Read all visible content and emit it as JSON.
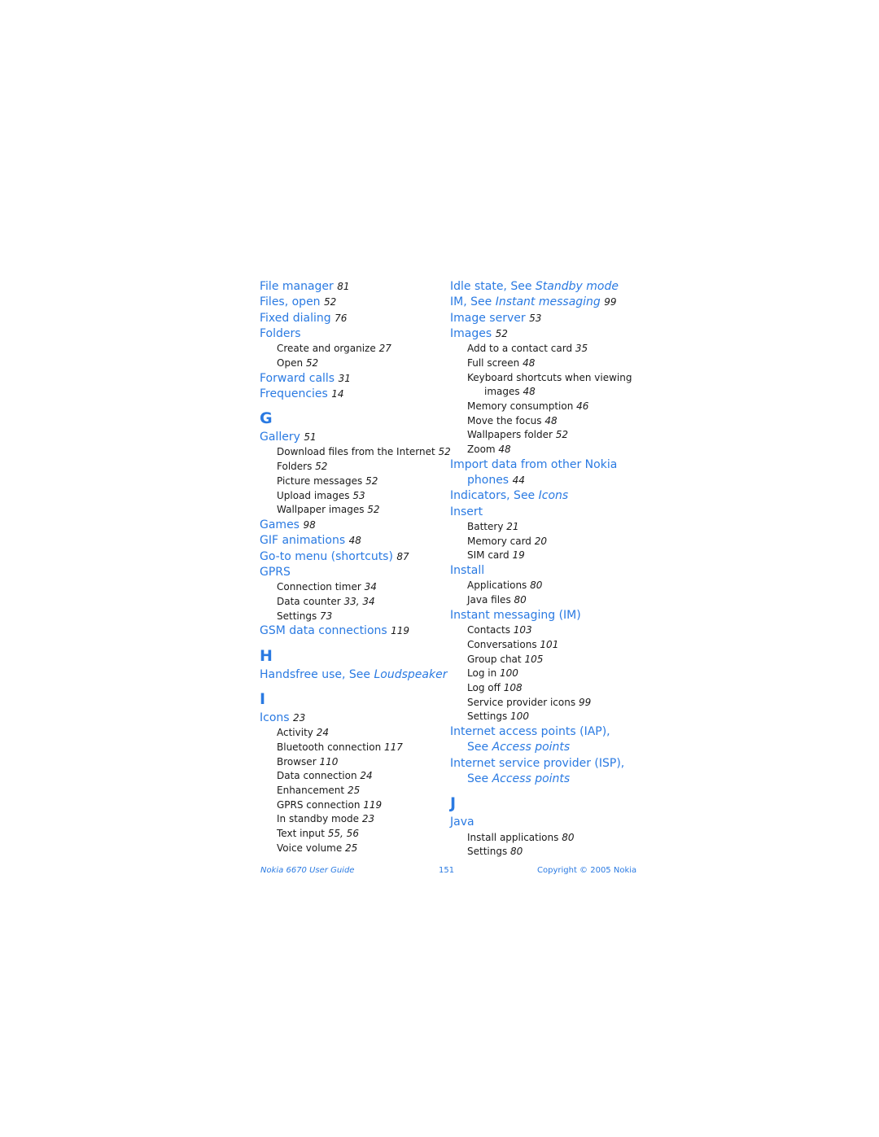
{
  "left_column": [
    {
      "type": "main",
      "text": "File manager",
      "pages": "81"
    },
    {
      "type": "main",
      "text": "Files, open",
      "pages": "52"
    },
    {
      "type": "main",
      "text": "Fixed dialing",
      "pages": "76"
    },
    {
      "type": "main",
      "text": "Folders",
      "pages": ""
    },
    {
      "type": "sub",
      "text": "Create and organize",
      "pages": "27"
    },
    {
      "type": "sub",
      "text": "Open",
      "pages": "52"
    },
    {
      "type": "main",
      "text": "Forward calls",
      "pages": "31"
    },
    {
      "type": "main",
      "text": "Frequencies",
      "pages": "14"
    },
    {
      "type": "letter",
      "text": "G"
    },
    {
      "type": "main",
      "text": "Gallery",
      "pages": "51"
    },
    {
      "type": "sub",
      "text": "Download files from the Internet",
      "pages": "52"
    },
    {
      "type": "sub",
      "text": "Folders",
      "pages": "52"
    },
    {
      "type": "sub",
      "text": "Picture messages",
      "pages": "52"
    },
    {
      "type": "sub",
      "text": "Upload images",
      "pages": "53"
    },
    {
      "type": "sub",
      "text": "Wallpaper images",
      "pages": "52"
    },
    {
      "type": "main",
      "text": "Games",
      "pages": "98"
    },
    {
      "type": "main",
      "text": "GIF animations",
      "pages": "48"
    },
    {
      "type": "main",
      "text": "Go-to menu (shortcuts)",
      "pages": "87"
    },
    {
      "type": "main",
      "text": "GPRS",
      "pages": ""
    },
    {
      "type": "sub",
      "text": "Connection timer",
      "pages": "34"
    },
    {
      "type": "sub",
      "text": "Data counter",
      "pages": "33, 34"
    },
    {
      "type": "sub",
      "text": "Settings",
      "pages": "73"
    },
    {
      "type": "main",
      "text": "GSM data connections",
      "pages": "119"
    },
    {
      "type": "letter",
      "text": "H"
    },
    {
      "type": "main",
      "text": "Handsfree use, See",
      "see": "Loudspeaker",
      "pages": ""
    },
    {
      "type": "letter",
      "text": "I"
    },
    {
      "type": "main",
      "text": "Icons",
      "pages": "23"
    },
    {
      "type": "sub",
      "text": "Activity",
      "pages": "24"
    },
    {
      "type": "sub",
      "text": "Bluetooth connection",
      "pages": "117"
    },
    {
      "type": "sub",
      "text": "Browser",
      "pages": "110"
    },
    {
      "type": "sub",
      "text": "Data connection",
      "pages": "24"
    },
    {
      "type": "sub",
      "text": "Enhancement",
      "pages": "25"
    },
    {
      "type": "sub",
      "text": "GPRS connection",
      "pages": "119"
    },
    {
      "type": "sub",
      "text": "In standby mode",
      "pages": "23"
    },
    {
      "type": "sub",
      "text": "Text input",
      "pages": "55, 56"
    },
    {
      "type": "sub",
      "text": "Voice volume",
      "pages": "25"
    }
  ],
  "right_column": [
    {
      "type": "main",
      "text": "Idle state, See",
      "see": "Standby mode",
      "pages": ""
    },
    {
      "type": "main",
      "text": "IM, See",
      "see": "Instant messaging",
      "pages": "99"
    },
    {
      "type": "main",
      "text": "Image server",
      "pages": "53"
    },
    {
      "type": "main",
      "text": "Images",
      "pages": "52"
    },
    {
      "type": "sub",
      "text": "Add to a contact card",
      "pages": "35"
    },
    {
      "type": "sub",
      "text": "Full screen",
      "pages": "48"
    },
    {
      "type": "sub",
      "text": "Keyboard shortcuts when viewing",
      "cont": "images",
      "pages": "48"
    },
    {
      "type": "sub",
      "text": "Memory consumption",
      "pages": "46"
    },
    {
      "type": "sub",
      "text": "Move the focus",
      "pages": "48"
    },
    {
      "type": "sub",
      "text": "Wallpapers folder",
      "pages": "52"
    },
    {
      "type": "sub",
      "text": "Zoom",
      "pages": "48"
    },
    {
      "type": "main",
      "text": "Import data from other Nokia",
      "cont": "phones",
      "pages": "44"
    },
    {
      "type": "main",
      "text": "Indicators, See",
      "see": "Icons",
      "pages": ""
    },
    {
      "type": "main",
      "text": "Insert",
      "pages": ""
    },
    {
      "type": "sub",
      "text": "Battery",
      "pages": "21"
    },
    {
      "type": "sub",
      "text": "Memory card",
      "pages": "20"
    },
    {
      "type": "sub",
      "text": "SIM card",
      "pages": "19"
    },
    {
      "type": "main",
      "text": "Install",
      "pages": ""
    },
    {
      "type": "sub",
      "text": "Applications",
      "pages": "80"
    },
    {
      "type": "sub",
      "text": "Java files",
      "pages": "80"
    },
    {
      "type": "main",
      "text": "Instant messaging (IM)",
      "pages": ""
    },
    {
      "type": "sub",
      "text": "Contacts",
      "pages": "103"
    },
    {
      "type": "sub",
      "text": "Conversations",
      "pages": "101"
    },
    {
      "type": "sub",
      "text": "Group chat",
      "pages": "105"
    },
    {
      "type": "sub",
      "text": "Log in",
      "pages": "100"
    },
    {
      "type": "sub",
      "text": "Log off",
      "pages": "108"
    },
    {
      "type": "sub",
      "text": "Service provider icons",
      "pages": "99"
    },
    {
      "type": "sub",
      "text": "Settings",
      "pages": "100"
    },
    {
      "type": "main",
      "text": "Internet access points (IAP),",
      "cont": "See",
      "see": "Access points",
      "pages": ""
    },
    {
      "type": "main",
      "text": "Internet service provider (ISP),",
      "cont": "See",
      "see": "Access points",
      "pages": ""
    },
    {
      "type": "letter",
      "text": "J"
    },
    {
      "type": "main",
      "text": "Java",
      "pages": ""
    },
    {
      "type": "sub",
      "text": "Install applications",
      "pages": "80"
    },
    {
      "type": "sub",
      "text": "Settings",
      "pages": "80"
    }
  ],
  "footer": {
    "guide_title": "Nokia 6670 User Guide",
    "page_number": "151",
    "copyright": "Copyright © 2005 Nokia"
  },
  "colors": {
    "link_blue": "#2a7ae2",
    "text": "#1a1a1a"
  }
}
